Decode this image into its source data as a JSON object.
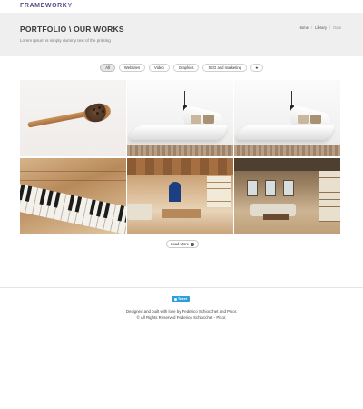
{
  "header": {
    "logo": "FRAMEWORK",
    "logo_accent": "Y"
  },
  "hero": {
    "title": "PORTFOLIO \\ OUR WORKS",
    "subtitle": "Lorem Ipsum is simply dummy text of the printing",
    "breadcrumb": [
      "Home",
      "Library",
      "Data"
    ]
  },
  "filters": [
    "All",
    "Websites",
    "Video",
    "Graphics",
    "SEO and marketing",
    "★"
  ],
  "gallery": [
    {
      "icon": "wooden-spoon-image"
    },
    {
      "icon": "white-chaise-image"
    },
    {
      "icon": "white-chaise-image"
    },
    {
      "icon": "piano-keys-image"
    },
    {
      "icon": "wooden-living-room-image"
    },
    {
      "icon": "modern-living-room-image"
    }
  ],
  "load_more": "Load More",
  "footer": {
    "tweet": "Tweet",
    "credit_line1": "Designed and built with love by Federico Schiocchet and Pixor.",
    "credit_line2": "© All Rights Reserved Federico Schiocchet - Pixor."
  },
  "colors": {
    "hero_bg": "#efefef",
    "logo": "#5b4a8b",
    "tweet": "#2a9ee0"
  }
}
